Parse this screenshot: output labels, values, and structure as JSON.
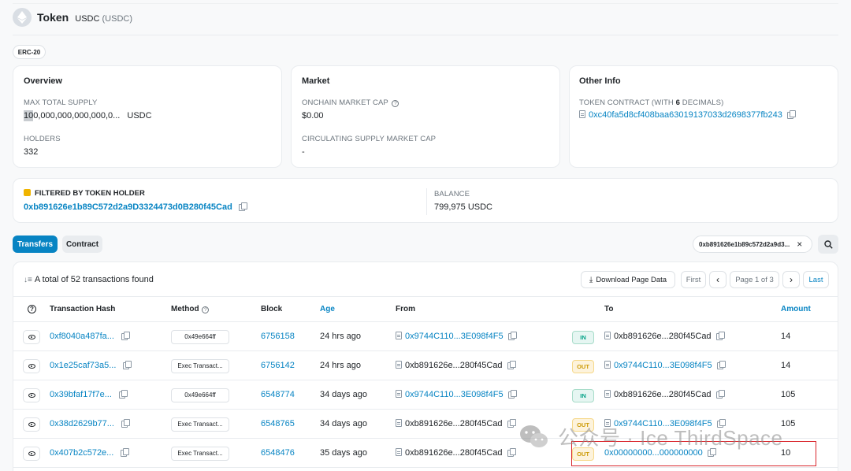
{
  "header": {
    "title": "Token",
    "token_name": "USDC",
    "token_symbol": "(USDC)",
    "badge": "ERC-20"
  },
  "overview": {
    "title": "Overview",
    "max_supply_label": "MAX TOTAL SUPPLY",
    "max_supply_value": "100,000,000,000,000,0...",
    "max_supply_unit": "USDC",
    "holders_label": "HOLDERS",
    "holders_value": "332"
  },
  "market": {
    "title": "Market",
    "onchain_cap_label": "ONCHAIN MARKET CAP",
    "onchain_cap_value": "$0.00",
    "circ_cap_label": "CIRCULATING SUPPLY MARKET CAP",
    "circ_cap_value": "-"
  },
  "other_info": {
    "title": "Other Info",
    "contract_label_prefix": "TOKEN CONTRACT (WITH ",
    "contract_label_decimals": "6",
    "contract_label_suffix": " DECIMALS)",
    "contract_address": "0xc40fa5d8cf408baa63019137033d2698377fb243"
  },
  "filter": {
    "label": "FILTERED BY TOKEN HOLDER",
    "address": "0xb891626e1b89C572d2a9D3324473d0B280f45Cad",
    "balance_label": "BALANCE",
    "balance_value": "799,975 USDC"
  },
  "tabs": {
    "transfers": "Transfers",
    "contract": "Contract"
  },
  "filter_chip": {
    "text": "0xb891626e1b89c572d2a9d3...",
    "close": "×"
  },
  "table": {
    "summary": "A total of 52 transactions found",
    "download_label": "Download Page Data",
    "first_label": "First",
    "prev_label": "‹",
    "page_label": "Page 1 of 3",
    "next_label": "›",
    "last_label": "Last",
    "headers": {
      "info": "",
      "hash": "Transaction Hash",
      "method": "Method",
      "block": "Block",
      "age": "Age",
      "from": "From",
      "to": "To",
      "amount": "Amount"
    },
    "rows": [
      {
        "hash": "0xf8040a487fa...",
        "method": "0x49e664ff",
        "block": "6756158",
        "age": "24 hrs ago",
        "from": "0x9744C110...3E098f4F5",
        "from_link": true,
        "dir": "IN",
        "to": "0xb891626e...280f45Cad",
        "to_link": false,
        "amount": "14"
      },
      {
        "hash": "0x1e25caf73a5...",
        "method": "Exec Transact...",
        "block": "6756142",
        "age": "24 hrs ago",
        "from": "0xb891626e...280f45Cad",
        "from_link": false,
        "dir": "OUT",
        "to": "0x9744C110...3E098f4F5",
        "to_link": true,
        "amount": "14"
      },
      {
        "hash": "0x39bfaf17f7e...",
        "method": "0x49e664ff",
        "block": "6548774",
        "age": "34 days ago",
        "from": "0x9744C110...3E098f4F5",
        "from_link": true,
        "dir": "IN",
        "to": "0xb891626e...280f45Cad",
        "to_link": false,
        "amount": "105"
      },
      {
        "hash": "0x38d2629b77...",
        "method": "Exec Transact...",
        "block": "6548765",
        "age": "34 days ago",
        "from": "0xb891626e...280f45Cad",
        "from_link": false,
        "dir": "OUT",
        "to": "0x9744C110...3E098f4F5",
        "to_link": true,
        "amount": "105"
      },
      {
        "hash": "0x407b2c572e...",
        "method": "Exec Transact...",
        "block": "6548476",
        "age": "35 days ago",
        "from": "0xb891626e...280f45Cad",
        "from_link": false,
        "dir": "OUT",
        "to": "0x00000000...000000000",
        "to_link": true,
        "amount": "10"
      }
    ]
  },
  "watermark": {
    "text": "公众号 · Ice ThirdSpace"
  },
  "colors": {
    "link": "#0784c3",
    "primary": "#0784c3",
    "highlight_box": "#d9262c"
  }
}
